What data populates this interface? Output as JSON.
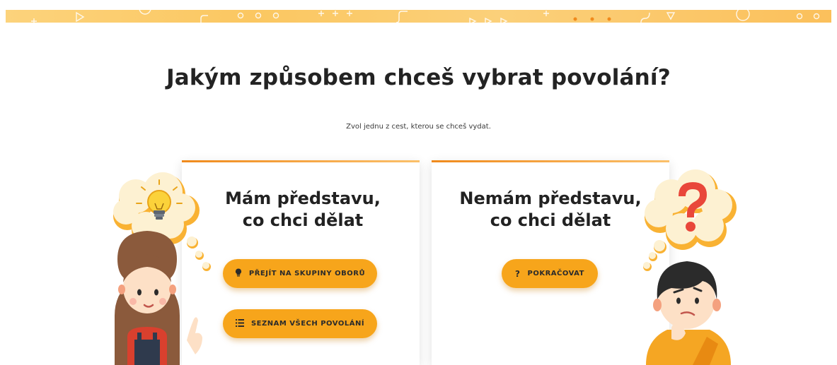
{
  "page": {
    "title": "Jakým způsobem chceš vybrat povolání?",
    "subtitle": "Zvol jednu z cest, kterou se chceš vydat."
  },
  "cards": {
    "left": {
      "title_line1": "Mám představu,",
      "title_line2": "co chci dělat",
      "buttons": [
        {
          "label": "PŘEJÍT NA SKUPINY OBORŮ",
          "icon": "lightbulb-icon"
        },
        {
          "label": "SEZNAM VŠECH POVOLÁNÍ",
          "icon": "list-icon"
        }
      ]
    },
    "right": {
      "title_line1": "Nemám představu,",
      "title_line2": "co chci dělat",
      "buttons": [
        {
          "label": "POKRAČOVAT",
          "icon": "question-icon"
        }
      ]
    }
  },
  "colors": {
    "accent": "#f7a51b",
    "card_top_border": "#f08a1c",
    "banner": "#fbc761",
    "text": "#232323"
  }
}
